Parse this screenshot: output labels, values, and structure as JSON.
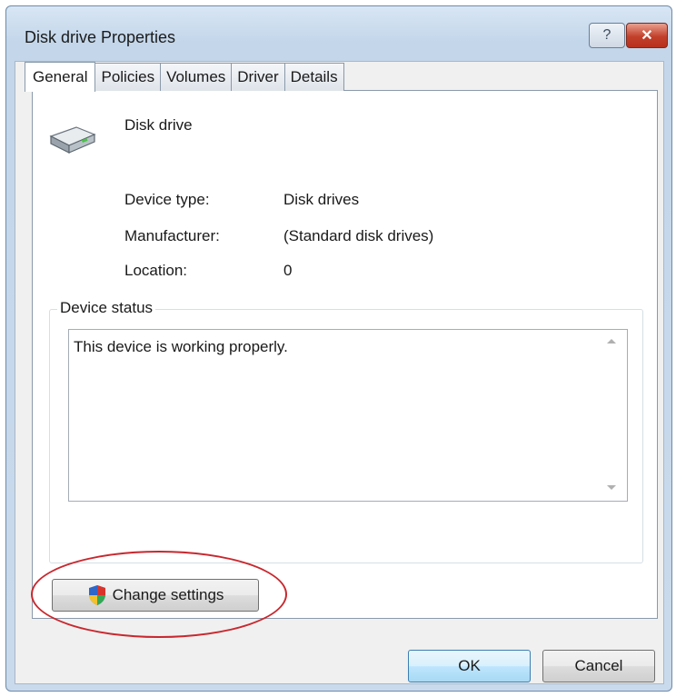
{
  "window": {
    "title": "Disk drive Properties",
    "help_label": "?",
    "close_label": "✕"
  },
  "tabs": [
    {
      "label": "General"
    },
    {
      "label": "Policies"
    },
    {
      "label": "Volumes"
    },
    {
      "label": "Driver"
    },
    {
      "label": "Details"
    }
  ],
  "active_tab": "General",
  "device": {
    "name": "Disk drive",
    "icon": "disk-drive-icon",
    "properties": [
      {
        "label": "Device type:",
        "value": "Disk drives"
      },
      {
        "label": "Manufacturer:",
        "value": "(Standard disk drives)"
      },
      {
        "label": "Location:",
        "value": "0"
      }
    ]
  },
  "status": {
    "group_label": "Device status",
    "text": "This device is working properly."
  },
  "buttons": {
    "change_settings": "Change settings",
    "ok": "OK",
    "cancel": "Cancel"
  },
  "colors": {
    "annotation_ellipse": "#c8282e",
    "close_button": "#c2402b",
    "default_button_border": "#3c7fb1"
  }
}
